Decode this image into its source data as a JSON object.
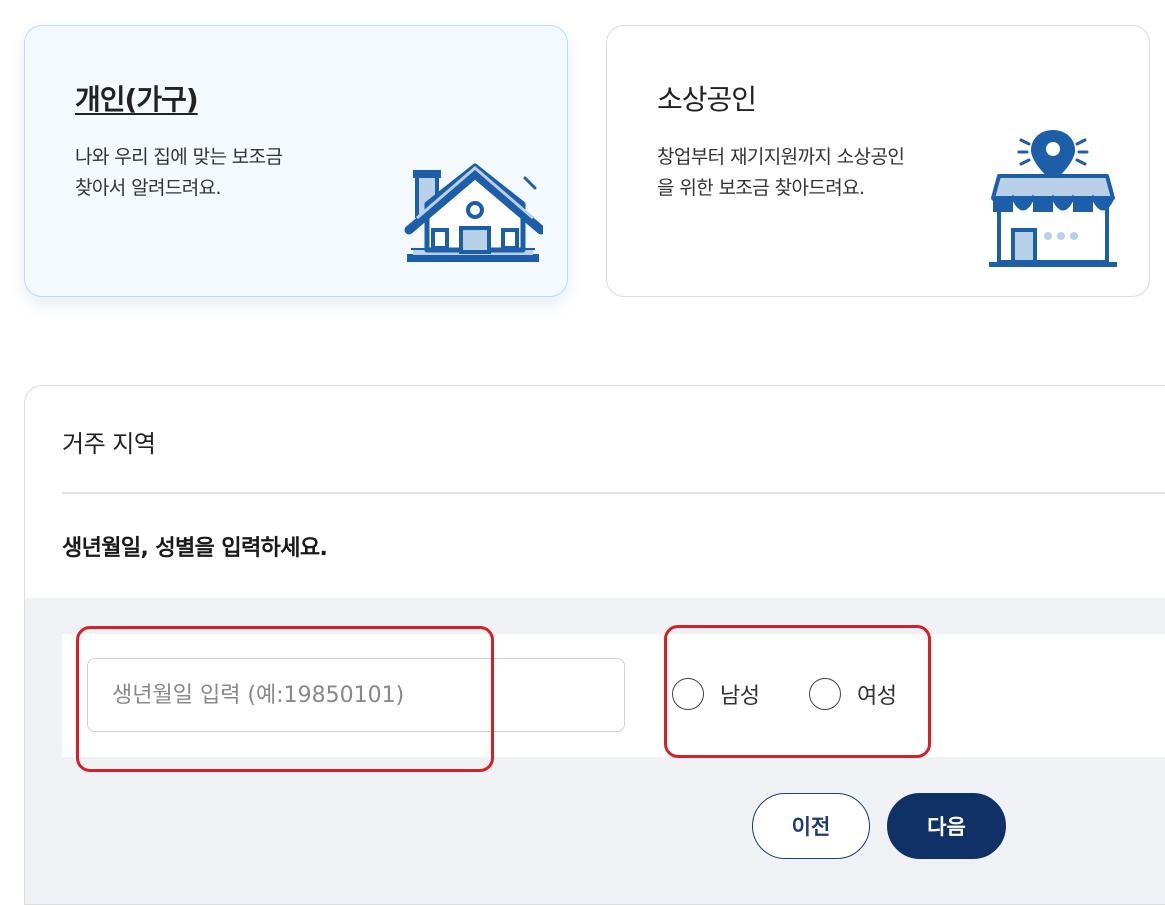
{
  "cards": {
    "personal": {
      "title": "개인(가구)",
      "desc_line1": "나와 우리 집에 맞는 보조금",
      "desc_line2": "찾아서 알려드려요.",
      "icon": "house-icon",
      "selected": true
    },
    "business": {
      "title": "소상공인",
      "desc_line1": "창업부터 재기지원까지 소상공인",
      "desc_line2": "을 위한 보조금 찾아드려요.",
      "icon": "storefront-location-icon",
      "selected": false
    }
  },
  "form": {
    "region_label": "거주 지역",
    "instruction": "생년월일, 성별을 입력하세요.",
    "birth_input": {
      "placeholder": "생년월일 입력 (예:19850101)",
      "value": ""
    },
    "gender_options": [
      {
        "label": "남성",
        "checked": false
      },
      {
        "label": "여성",
        "checked": false
      }
    ],
    "prev_button": "이전",
    "next_button": "다음"
  },
  "colors": {
    "accent_navy": "#0f3166",
    "icon_blue": "#1d5ea8",
    "icon_light": "#b8d0e8",
    "highlight_red": "#d62027",
    "selected_card_bg": "#f3f9fd"
  }
}
